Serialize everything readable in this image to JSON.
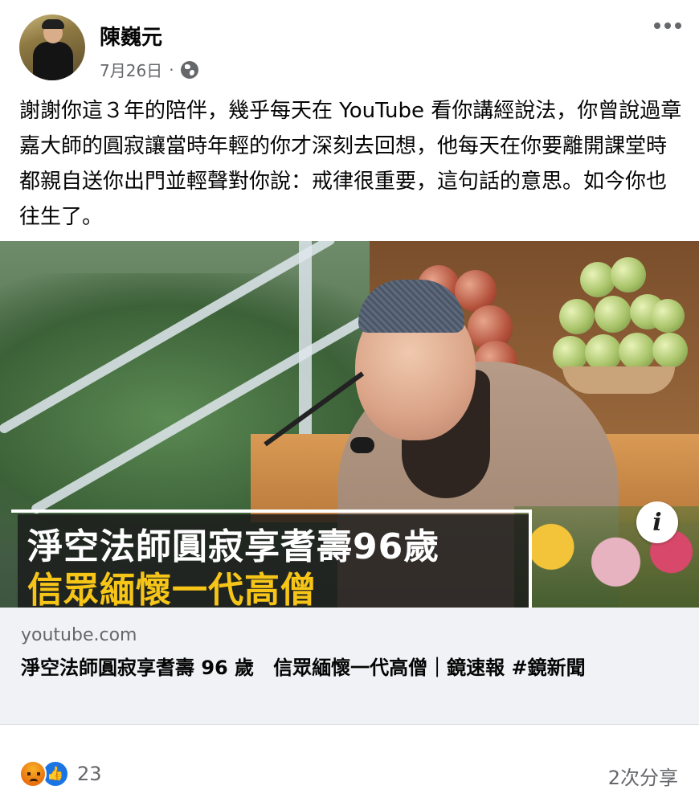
{
  "post": {
    "author": "陳巍元",
    "date": "7月26日",
    "separator": "·",
    "audience_icon": "globe-icon",
    "more_icon": "more-options-icon",
    "text": "謝謝你這３年的陪伴，幾乎每天在 YouTube 看你講經說法，你曾說過章嘉大師的圓寂讓當時年輕的你才深刻去回想，他每天在你要離開課堂時都親自送你出門並輕聲對你說：戒律很重要，這句話的意思。如今你也往生了。"
  },
  "link_preview": {
    "image_caption_line1": "淨空法師圓寂享耆壽96歲",
    "image_caption_line2": "信眾緬懷一代高僧",
    "info_badge": "i",
    "domain": "youtube.com",
    "title": "淨空法師圓寂享耆壽 96 歲　信眾緬懷一代高僧｜鏡速報 #鏡新聞"
  },
  "footer": {
    "reaction_icons": [
      "angry-reaction-icon",
      "like-reaction-icon"
    ],
    "reaction_count": "23",
    "shares": "2次分享"
  },
  "colors": {
    "caption_yellow": "#f6c518",
    "secondary_text": "#65676b",
    "like_blue": "#1b74e4"
  }
}
